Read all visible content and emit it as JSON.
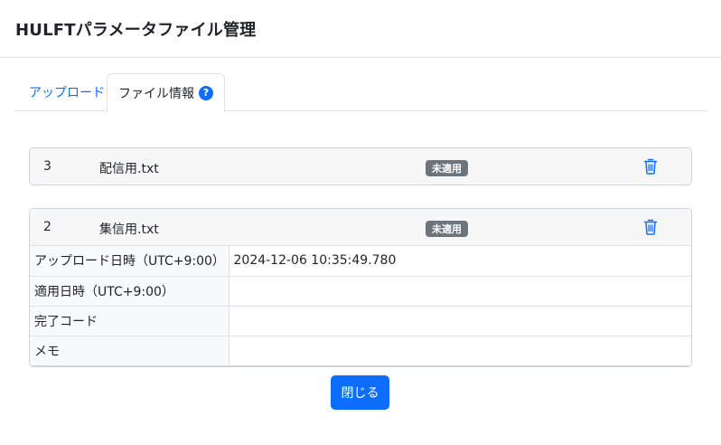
{
  "modal": {
    "title": "HULFTパラメータファイル管理",
    "close_label": "閉じる"
  },
  "tabs": {
    "upload": "アップロード",
    "info": "ファイル情報",
    "help_glyph": "?"
  },
  "files": [
    {
      "number": "3",
      "name": "配信用.txt",
      "status": "未適用"
    },
    {
      "number": "2",
      "name": "集信用.txt",
      "status": "未適用"
    }
  ],
  "details": [
    {
      "label": "アップロード日時（UTC+9:00）",
      "value": "2024-12-06 10:35:49.780"
    },
    {
      "label": "適用日時（UTC+9:00）",
      "value": ""
    },
    {
      "label": "完了コード",
      "value": ""
    },
    {
      "label": "メモ",
      "value": ""
    }
  ],
  "icons": {
    "delete": "trash-icon",
    "help": "question-circle-icon"
  },
  "colors": {
    "primary": "#0d6efd",
    "badge": "#6c757d"
  }
}
